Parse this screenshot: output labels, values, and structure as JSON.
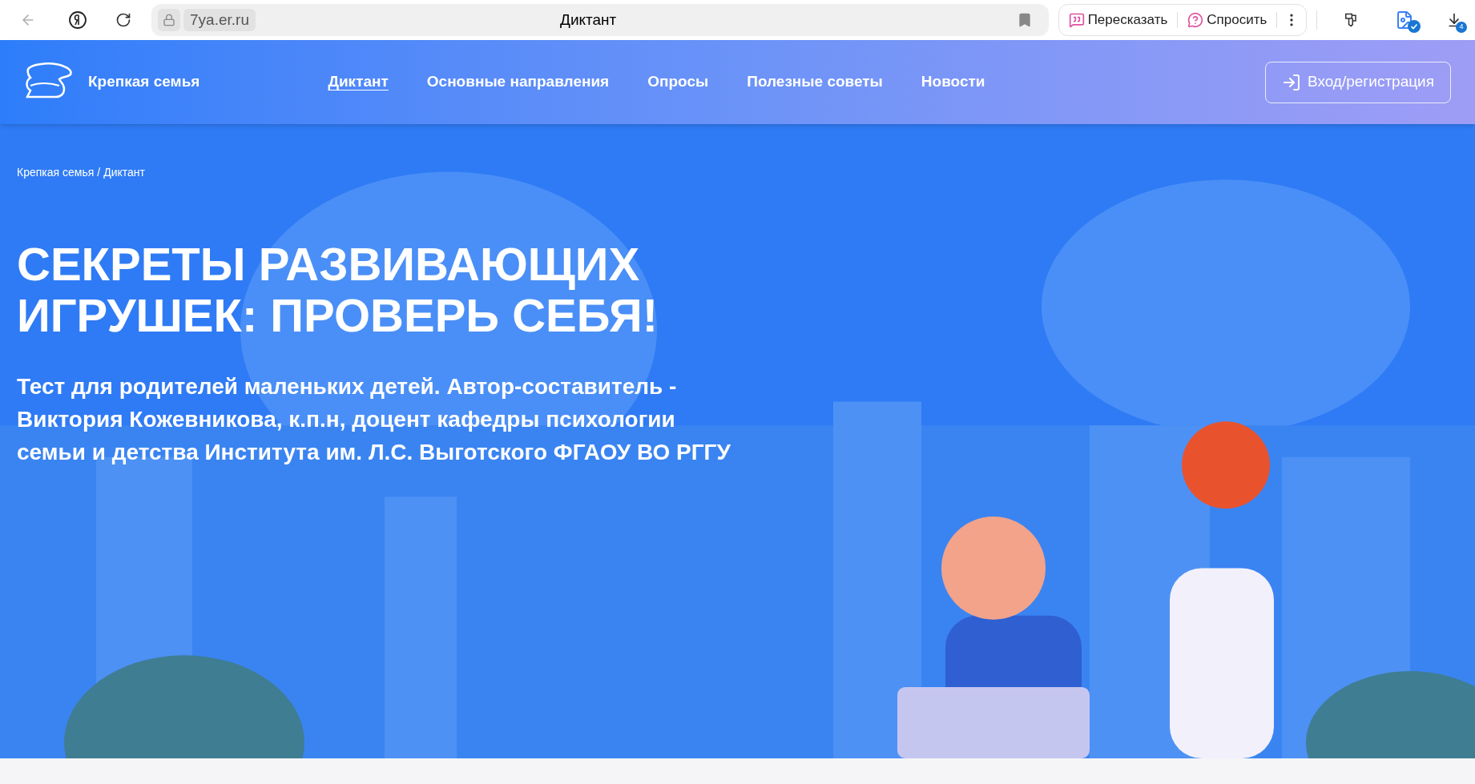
{
  "browser": {
    "address": "7ya.er.ru",
    "title": "Диктант",
    "actions": [
      {
        "kind": "retell",
        "label": "Пересказать"
      },
      {
        "kind": "ask",
        "label": "Спросить"
      }
    ],
    "downloads_badge": "4"
  },
  "header": {
    "brand": "Крепкая семья",
    "nav": [
      {
        "label": "Диктант",
        "selected": true
      },
      {
        "label": "Основные направления",
        "selected": false
      },
      {
        "label": "Опросы",
        "selected": false
      },
      {
        "label": "Полезные советы",
        "selected": false
      },
      {
        "label": "Новости",
        "selected": false
      }
    ],
    "login": "Вход/регистрация"
  },
  "hero": {
    "breadcrumb": [
      {
        "label": "Крепкая семья"
      },
      {
        "label": "Диктант"
      }
    ],
    "separator": "/",
    "title": "СЕКРЕТЫ РАЗВИВАЮЩИХ ИГРУШЕК: ПРОВЕРЬ СЕБЯ!",
    "subtitle": "Тест для родителей маленьких детей. Автор-составитель - Виктория Кожевникова, к.п.н, доцент кафедры психологии семьи и детства Института им. Л.С. Выготского ФГАОУ ВО РГГУ"
  }
}
